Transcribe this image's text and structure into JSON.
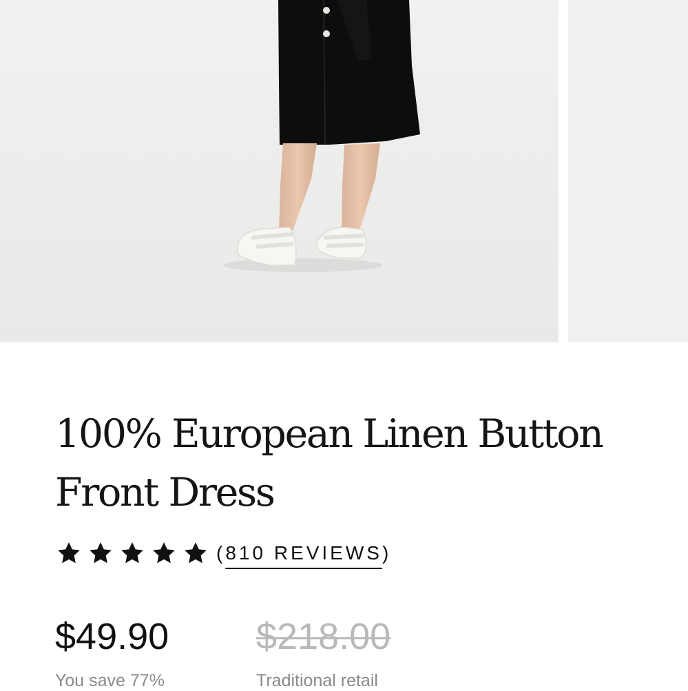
{
  "product": {
    "title": "100% European Linen Button Front Dress",
    "rating": 5,
    "reviews_label": "810 REVIEWS",
    "reviews_open": "(",
    "reviews_close": ")",
    "price": "$49.90",
    "savings": "You save 77%",
    "retail_price": "$218.00",
    "retail_label": "Traditional retail"
  },
  "gallery": {
    "images": [
      "product-photo",
      "product-photo-next"
    ]
  }
}
